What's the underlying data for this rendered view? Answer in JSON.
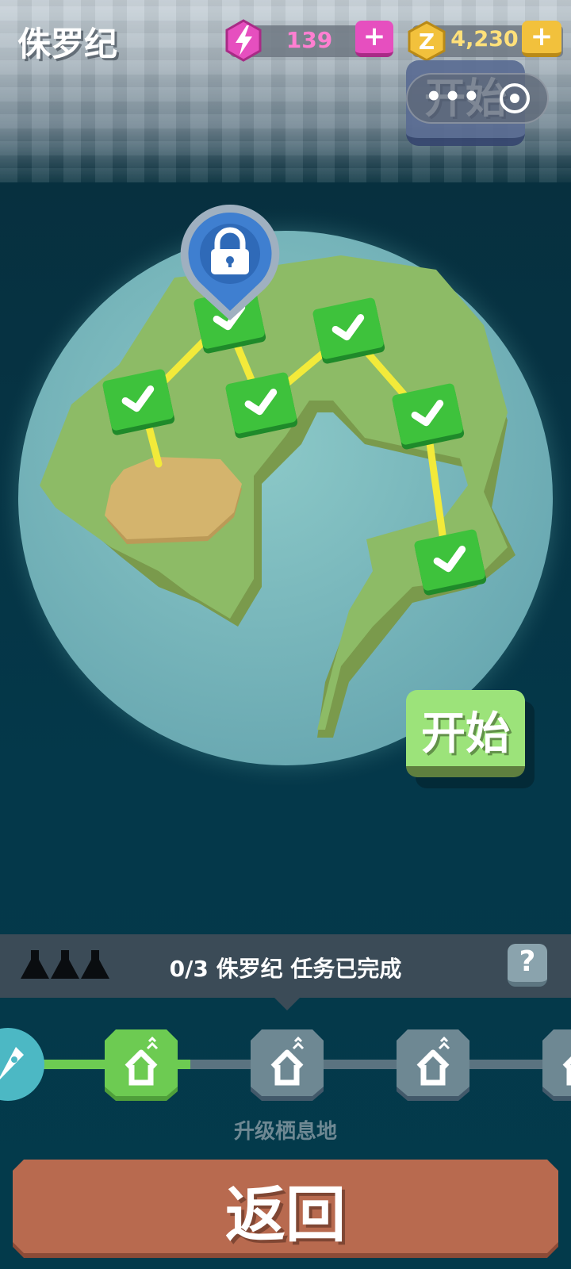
{
  "header": {
    "level_title": "侏罗纪",
    "energy": {
      "value": "139",
      "plus_label": "+",
      "icon": "lightning-icon",
      "color": "#e64fbf"
    },
    "coins": {
      "value": "4,230",
      "plus_label": "+",
      "icon": "coin-z-icon",
      "color": "#f2c13c"
    }
  },
  "top_start_button": {
    "label": "开始"
  },
  "capsule": {
    "dots": "•••",
    "icon": "target-icon"
  },
  "map": {
    "nodes": [
      {
        "id": "node-1",
        "state": "completed"
      },
      {
        "id": "node-2",
        "state": "completed"
      },
      {
        "id": "node-3",
        "state": "completed"
      },
      {
        "id": "node-4",
        "state": "completed"
      },
      {
        "id": "node-5",
        "state": "completed"
      },
      {
        "id": "node-6",
        "state": "completed"
      }
    ],
    "pin_icon": "lock-icon",
    "colors": {
      "land": "#8dbb66",
      "ocean": "#79bcc0",
      "path": "#f2ea3a",
      "node": "#3ec23c",
      "desert": "#d4b46d"
    }
  },
  "start_button": {
    "label": "开始"
  },
  "mission_bar": {
    "progress_text": "0/3 侏罗纪 任务已完成",
    "flask_icons": [
      "flask-icon",
      "flask-icon",
      "flask-icon"
    ],
    "help_label": "?"
  },
  "progress_track": {
    "start_icon": "rocket-icon",
    "stages": [
      {
        "icon": "home-upgrade-icon",
        "state": "active"
      },
      {
        "icon": "home-upgrade-icon",
        "state": "locked"
      },
      {
        "icon": "home-upgrade-icon",
        "state": "locked"
      },
      {
        "icon": "home-upgrade-icon",
        "state": "locked"
      }
    ],
    "label": "升级栖息地"
  },
  "back_button": {
    "label": "返回"
  }
}
